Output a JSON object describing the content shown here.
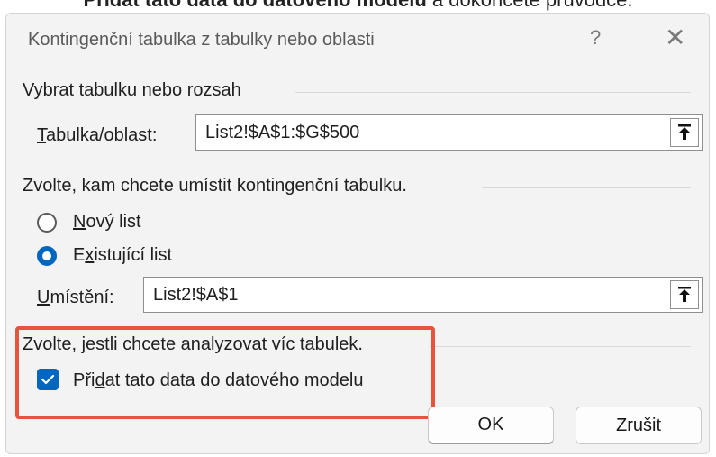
{
  "page_header_fragment": {
    "bold": "Přidat tato data do datového modelu",
    "rest": " a dokončete průvodce."
  },
  "dialog": {
    "title": "Kontingenční tabulka z tabulky nebo oblasti",
    "help": "?",
    "close": "✕"
  },
  "select_section": {
    "heading": "Vybrat tabulku nebo rozsah",
    "range_label_ul": "T",
    "range_label_rest": "abulka/oblast:",
    "range_value": "List2!$A$1:$G$500"
  },
  "location_section": {
    "heading": "Zvolte, kam chcete umístit kontingenční tabulku.",
    "new_sheet_ul": "N",
    "new_sheet_rest": "ový list",
    "existing_sheet_pre": "E",
    "existing_sheet_ul": "x",
    "existing_sheet_rest": "istující list",
    "selected_option": "existing",
    "place_label_ul": "U",
    "place_label_rest": "místění:",
    "place_value": "List2!$A$1"
  },
  "multi_section": {
    "heading": "Zvolte, jestli chcete analyzovat víc tabulek.",
    "add_model_pre": "Při",
    "add_model_ul": "d",
    "add_model_rest": "at tato data do datového modelu",
    "checked": true
  },
  "buttons": {
    "ok": "OK",
    "cancel": "Zrušit"
  },
  "colors": {
    "accent": "#0067c0",
    "highlight": "#e8533e"
  },
  "icons": {
    "collapse": "upload-arrow-icon",
    "check": "check-icon",
    "close": "close-icon",
    "help": "help-icon"
  }
}
